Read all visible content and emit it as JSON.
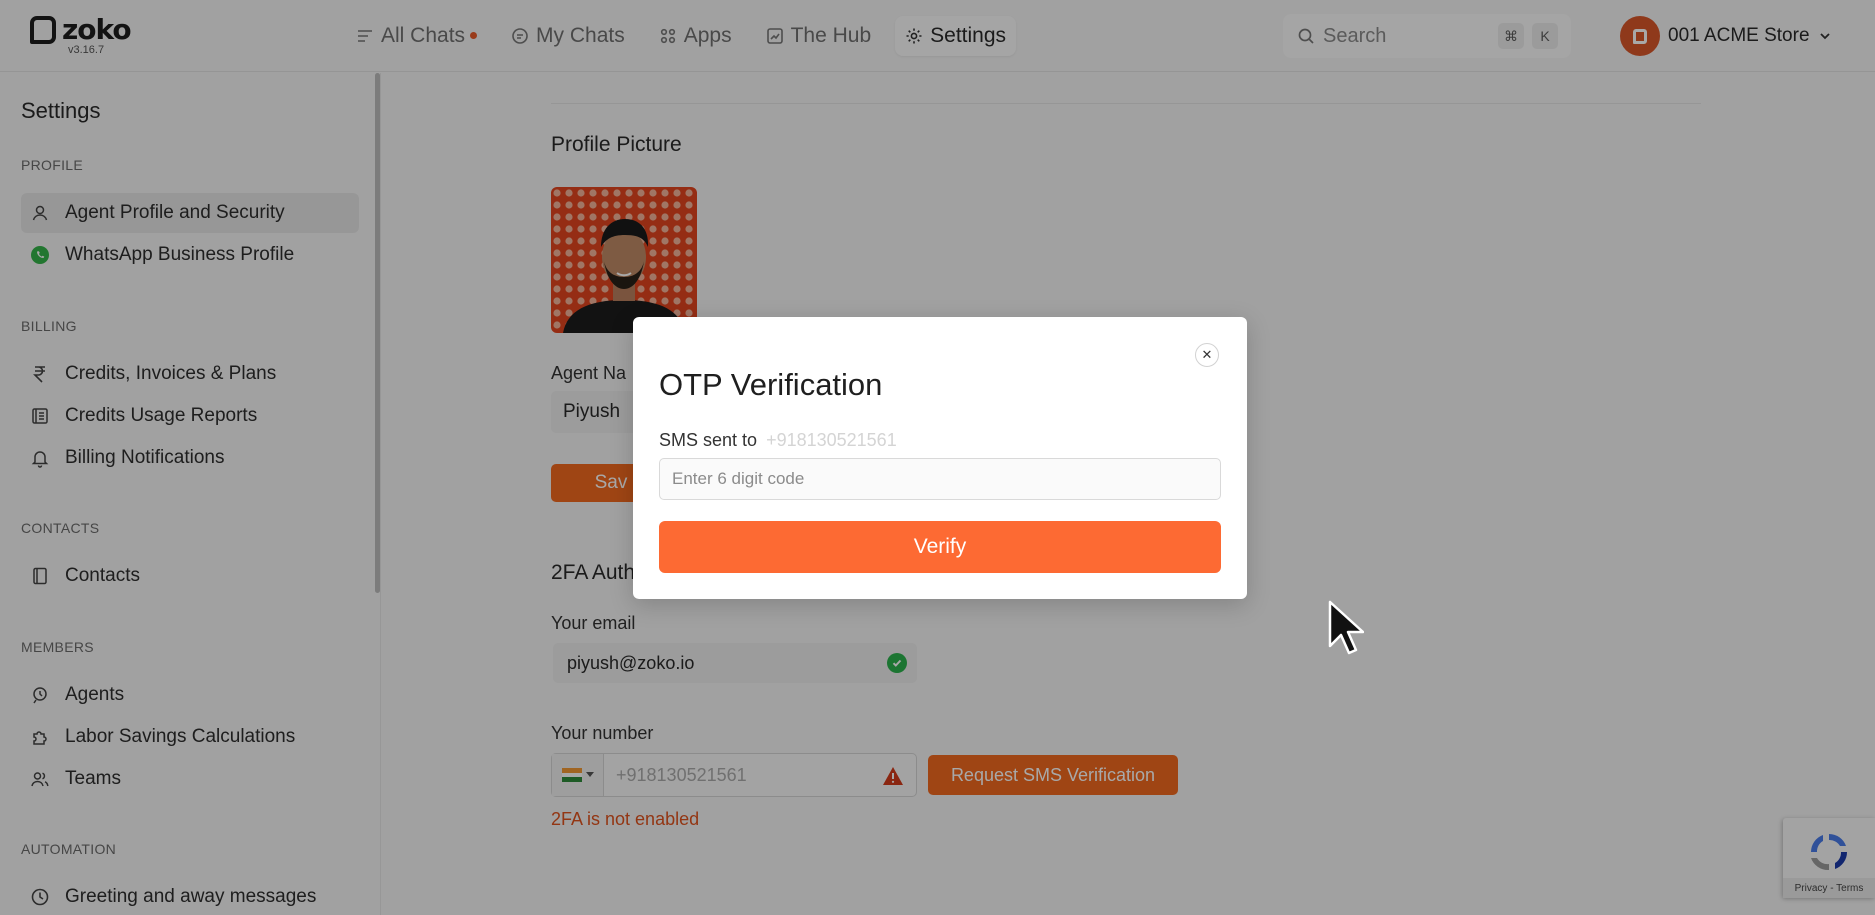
{
  "app": {
    "logo_text": "zoko",
    "version": "v3.16.7"
  },
  "nav": {
    "items": [
      {
        "label": "All Chats",
        "icon": "all-chats-icon",
        "has_dot": true
      },
      {
        "label": "My Chats",
        "icon": "my-chats-icon"
      },
      {
        "label": "Apps",
        "icon": "apps-icon"
      },
      {
        "label": "The Hub",
        "icon": "hub-icon"
      },
      {
        "label": "Settings",
        "icon": "gear-icon",
        "active": true
      }
    ],
    "search_label": "Search",
    "search_shortcut": [
      "⌘",
      "K"
    ],
    "store_name": "001 ACME Store"
  },
  "sidebar": {
    "title": "Settings",
    "sections": {
      "profile": "PROFILE",
      "billing": "BILLING",
      "contacts": "CONTACTS",
      "members": "MEMBERS",
      "automation": "AUTOMATION"
    },
    "items": {
      "agent_profile": "Agent Profile and Security",
      "whatsapp_profile": "WhatsApp Business Profile",
      "credits_invoices": "Credits, Invoices & Plans",
      "credits_usage": "Credits Usage Reports",
      "billing_notifications": "Billing Notifications",
      "contacts": "Contacts",
      "agents": "Agents",
      "labor_savings": "Labor Savings Calculations",
      "teams": "Teams",
      "greeting": "Greeting and away messages"
    }
  },
  "main": {
    "profile_picture_heading": "Profile Picture",
    "agent_name_label": "Agent Na",
    "agent_name_value": "Piyush",
    "save_label": "Sav",
    "twofa_heading": "2FA Auth",
    "email_label": "Your email",
    "email_value": "piyush@zoko.io",
    "number_label": "Your number",
    "number_value": "+918130521561",
    "request_sms_label": "Request SMS Verification",
    "twofa_status": "2FA is not enabled"
  },
  "modal": {
    "title": "OTP Verification",
    "sms_sent_label": "SMS sent to",
    "sms_number": "+918130521561",
    "otp_placeholder": "Enter 6 digit code",
    "verify_label": "Verify",
    "close_symbol": "✕"
  },
  "recaptcha": {
    "footer": "Privacy - Terms"
  },
  "colors": {
    "accent": "#fd6a33",
    "success": "#2bb24c",
    "error": "#e0531e"
  }
}
